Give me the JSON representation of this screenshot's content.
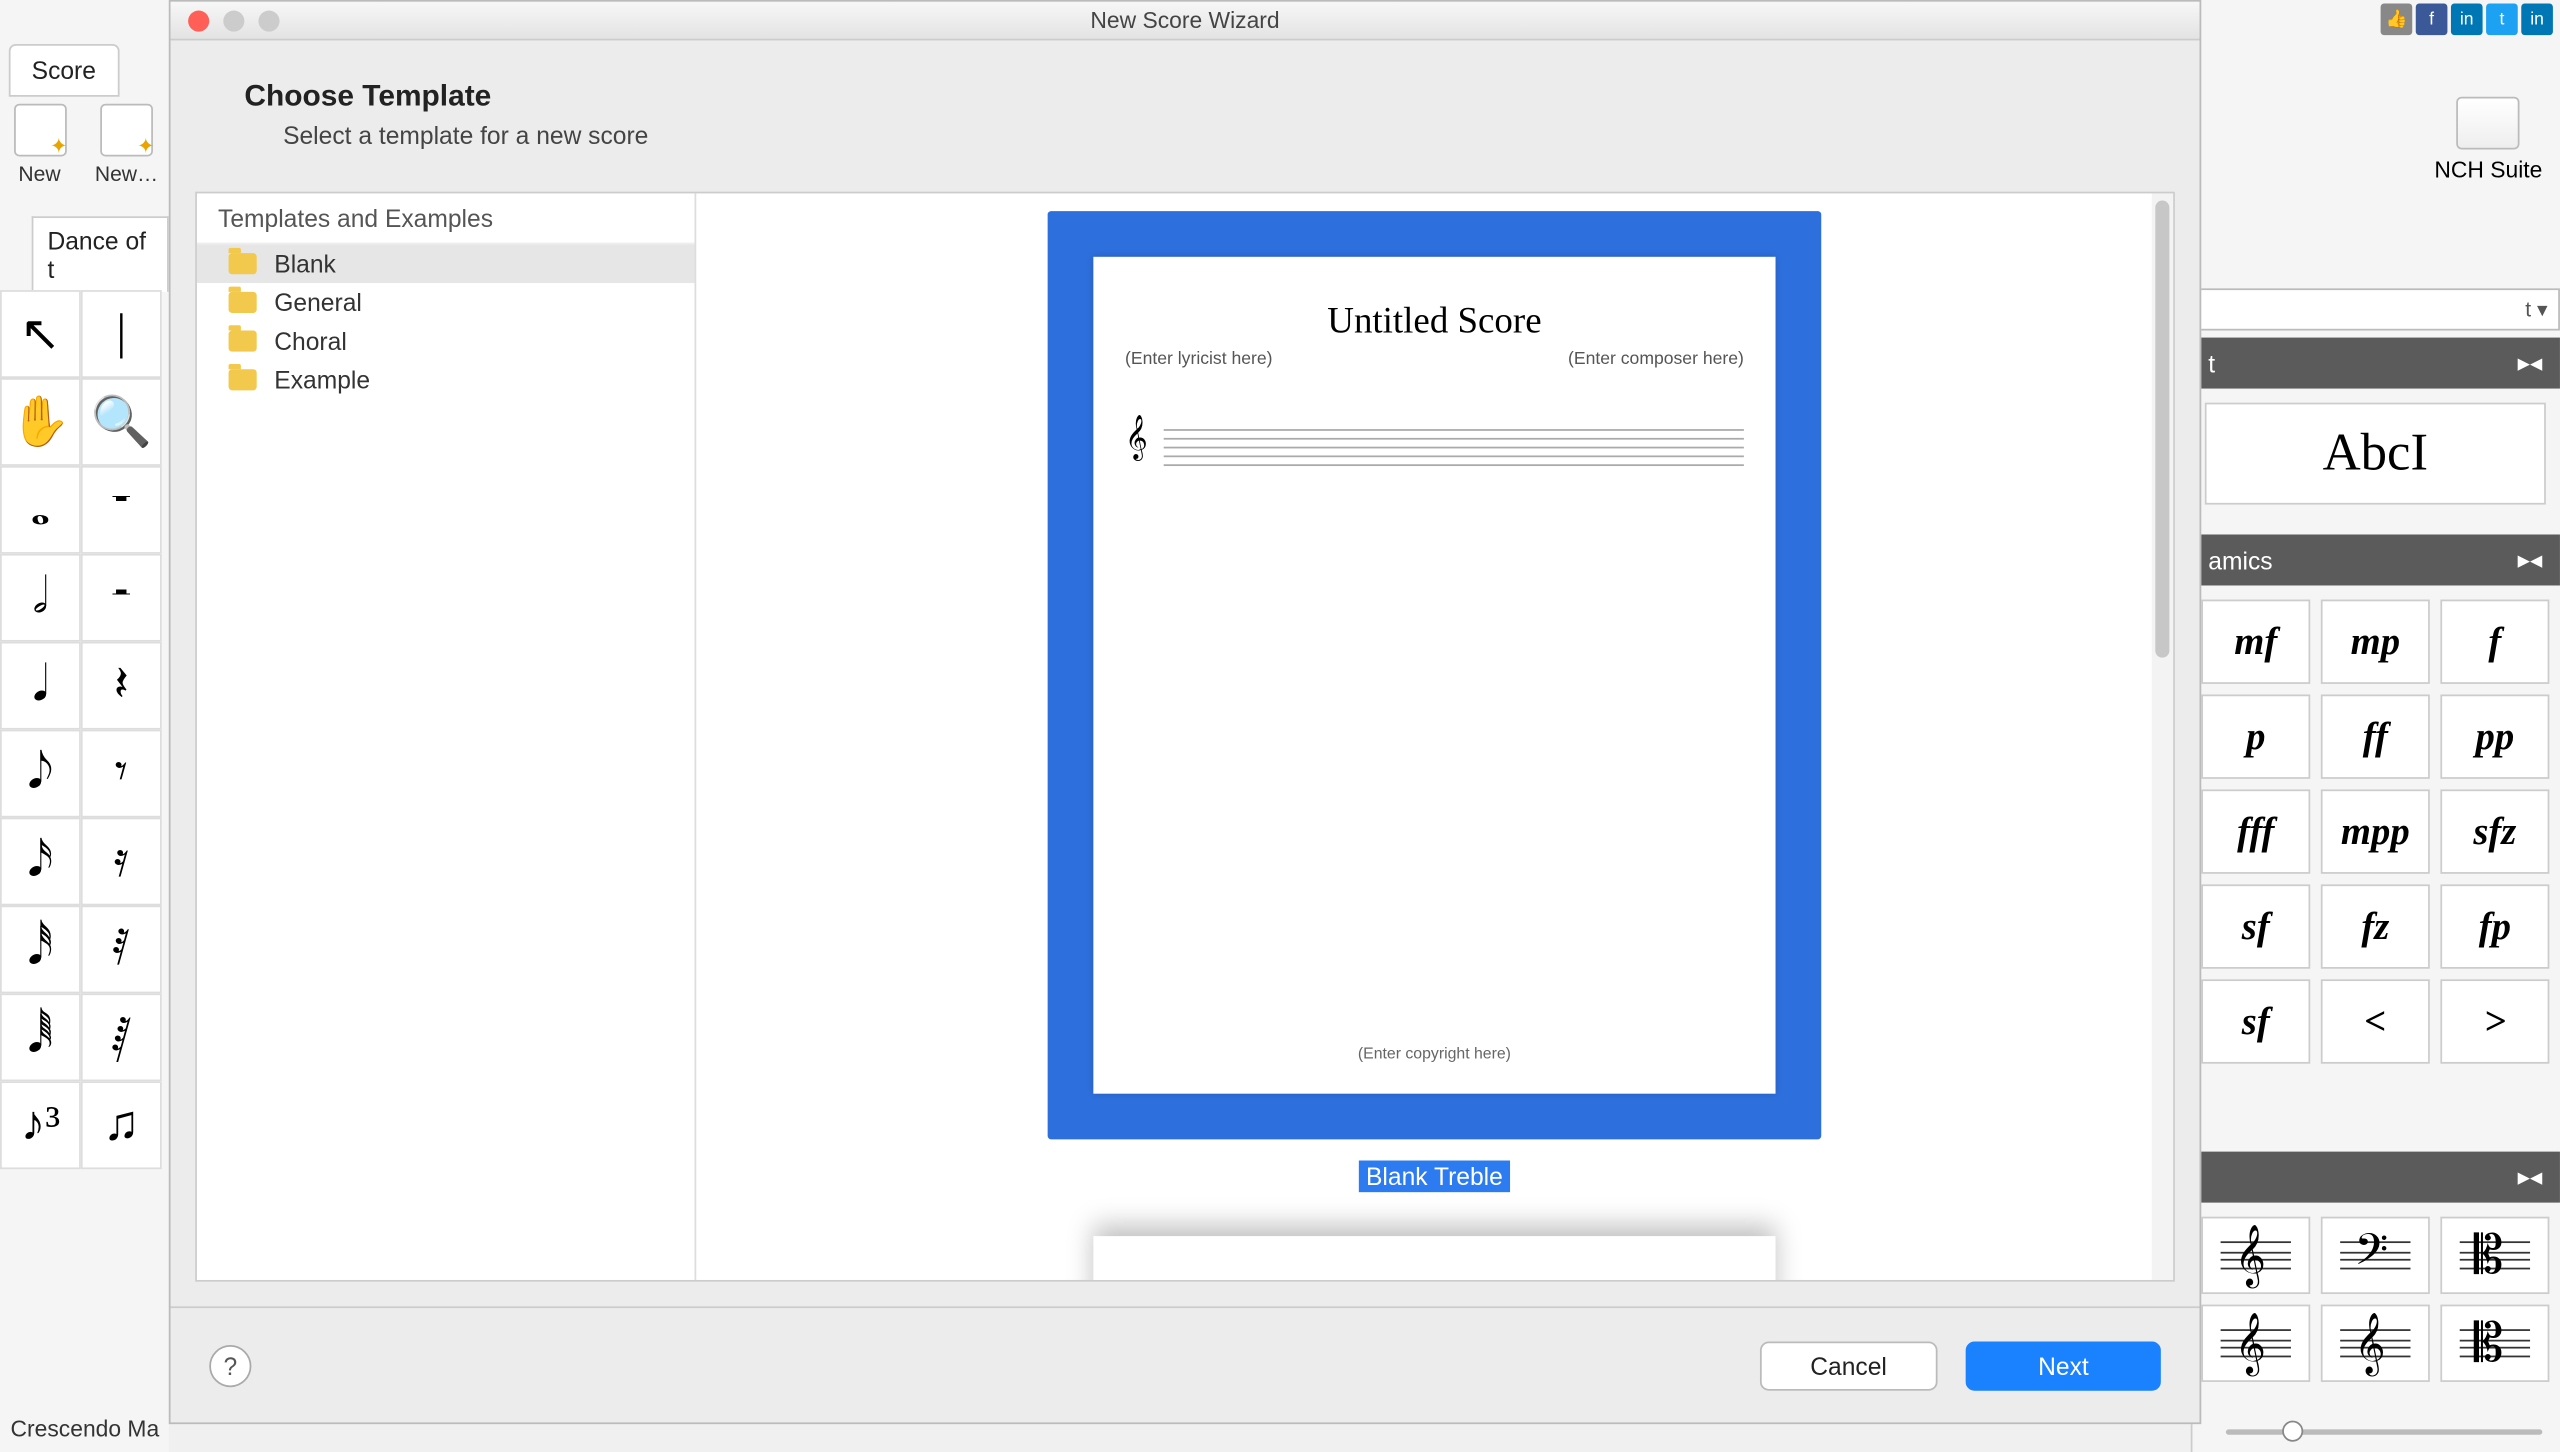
{
  "app": {
    "tab": "Score",
    "toolbar": {
      "new": "New",
      "new2": "New…"
    },
    "doc_tab": "Dance of t",
    "status": "Crescendo Ma",
    "nch_suite": "NCH Suite"
  },
  "panels": {
    "text_header": "t",
    "text_sample": "AbcI",
    "dynamics_header": "amics",
    "dynamics": [
      "mf",
      "mp",
      "f",
      "p",
      "ff",
      "pp",
      "fff",
      "mpp",
      "sfz",
      "sf",
      "fz",
      "fp",
      "sf",
      "<",
      ">"
    ],
    "clef_header": ""
  },
  "wizard": {
    "title": "New Score Wizard",
    "heading": "Choose Template",
    "subheading": "Select a template for a new score",
    "tree_header": "Templates and Examples",
    "templates": [
      {
        "name": "Blank",
        "selected": true
      },
      {
        "name": "General",
        "selected": false
      },
      {
        "name": "Choral",
        "selected": false
      },
      {
        "name": "Example",
        "selected": false
      }
    ],
    "preview": {
      "score_title": "Untitled Score",
      "lyricist": "(Enter lyricist here)",
      "composer": "(Enter composer here)",
      "copyright": "(Enter copyright here)",
      "label": "Blank Treble"
    },
    "buttons": {
      "help": "?",
      "cancel": "Cancel",
      "next": "Next"
    }
  },
  "note_palette": [
    "↖",
    "|",
    "✋",
    "🔍",
    "𝅝",
    "𝄻",
    "𝅗𝅥",
    "𝄼",
    "𝅘𝅥",
    "𝄽",
    "𝅘𝅥𝅮",
    "𝄾",
    "𝅘𝅥𝅯",
    "𝄿",
    "𝅘𝅥𝅰",
    "𝅀",
    "𝅘𝅥𝅱",
    "𝅁",
    "♪³",
    "♫"
  ]
}
